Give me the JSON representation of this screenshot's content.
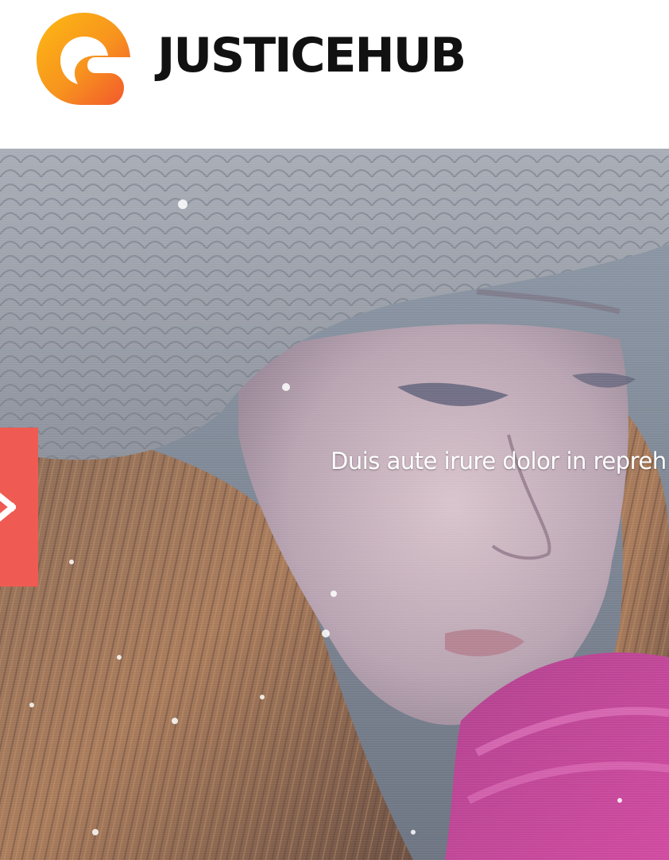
{
  "header": {
    "brand_name": "JUSTICEHUB",
    "logo_icon": "brand-logo-icon"
  },
  "hero": {
    "caption": "Duis aute irure dolor in repreh",
    "side_tab_icon": "close-icon"
  },
  "colors": {
    "logo_orange": "#f7931e",
    "logo_red": "#f2542d",
    "side_tab": "#ef5b52",
    "brand_text": "#111111",
    "caption_text": "#ffffff"
  }
}
